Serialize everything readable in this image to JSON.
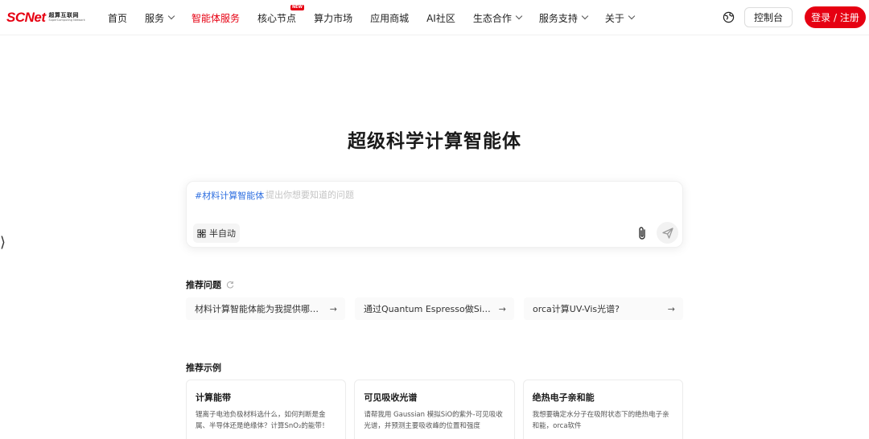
{
  "header": {
    "logo_mark": "SCNet",
    "logo_cn": "超算互联网",
    "logo_en": "SuperComputing Network",
    "nav": [
      {
        "label": "首页",
        "chevron": false,
        "active": false
      },
      {
        "label": "服务",
        "chevron": true,
        "active": false
      },
      {
        "label": "智能体服务",
        "chevron": false,
        "active": true
      },
      {
        "label": "核心节点",
        "chevron": false,
        "active": false,
        "badge": "NEW"
      },
      {
        "label": "算力市场",
        "chevron": false,
        "active": false
      },
      {
        "label": "应用商城",
        "chevron": false,
        "active": false
      },
      {
        "label": "AI社区",
        "chevron": false,
        "active": false
      },
      {
        "label": "生态合作",
        "chevron": true,
        "active": false
      },
      {
        "label": "服务支持",
        "chevron": true,
        "active": false
      },
      {
        "label": "关于",
        "chevron": true,
        "active": false
      }
    ],
    "console_label": "控制台",
    "login_label": "登录 / 注册"
  },
  "side_handle": "⟩",
  "hero": {
    "title": "超级科学计算智能体"
  },
  "chat": {
    "tag": "#材料计算智能体",
    "placeholder": "提出你想要知道的问题",
    "value": "",
    "mode_label": "半自动"
  },
  "recommend": {
    "title": "推荐问题",
    "questions": [
      "材料计算智能体能为我提供哪些…",
      "通过Quantum Espresso做Si晶体…",
      "orca计算UV-Vis光谱?"
    ]
  },
  "examples": {
    "title": "推荐示例",
    "items": [
      {
        "title": "计算能带",
        "desc": "锂离子电池负极材料选什么，如何判断是金属、半导体还是绝缘体？计算SnO₂的能带！"
      },
      {
        "title": "可见吸收光谱",
        "desc": "请帮我用 Gaussian 模拟SiO的紫外-可见吸收光谱，并预测主要吸收峰的位置和强度"
      },
      {
        "title": "绝热电子亲和能",
        "desc": "我想要确定水分子在吸附状态下的绝热电子亲和能，orca软件"
      }
    ]
  },
  "colors": {
    "brand": "#e60012",
    "tag": "#2f6fe0"
  }
}
